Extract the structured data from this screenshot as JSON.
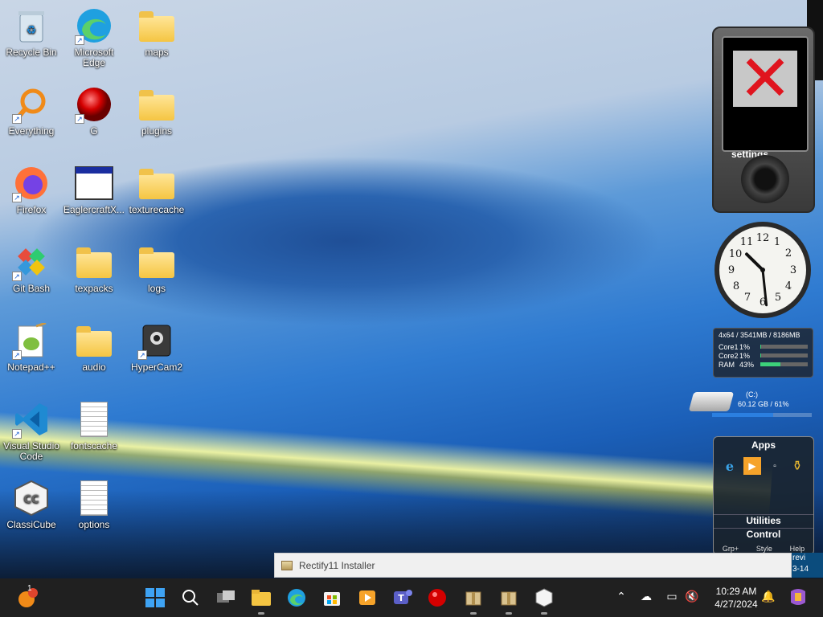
{
  "desktop": {
    "icons": [
      {
        "label": "Recycle Bin"
      },
      {
        "label": "Microsoft Edge"
      },
      {
        "label": "maps"
      },
      {
        "label": "Everything"
      },
      {
        "label": "G"
      },
      {
        "label": "plugins"
      },
      {
        "label": "Firefox"
      },
      {
        "label": "EaglercraftX..."
      },
      {
        "label": "texturecache"
      },
      {
        "label": "Git Bash"
      },
      {
        "label": "texpacks"
      },
      {
        "label": "logs"
      },
      {
        "label": "Notepad++"
      },
      {
        "label": "audio"
      },
      {
        "label": "HyperCam2"
      },
      {
        "label": "Visual Studio Code"
      },
      {
        "label": "fontscache"
      },
      {
        "label": "ClassiCube"
      },
      {
        "label": "options"
      }
    ]
  },
  "gadgets": {
    "zune": {
      "settings_label": "settings"
    },
    "clock": {
      "hour": 10,
      "minute": 29
    },
    "cpu": {
      "header": "4x64 / 3541MB / 8186MB",
      "rows": [
        {
          "label": "Core1",
          "value": "1%",
          "fraction": 0.01
        },
        {
          "label": "Core2",
          "value": "1%",
          "fraction": 0.01
        },
        {
          "label": "RAM",
          "value": "43%",
          "fraction": 0.43
        }
      ]
    },
    "drive": {
      "name": "(C:)",
      "info": "60.12 GB / 61%",
      "fraction": 0.61
    },
    "apps": {
      "title": "Apps",
      "section_utilities": "Utilities",
      "section_control": "Control",
      "footer": [
        "Grp+",
        "Style",
        "Help"
      ]
    }
  },
  "installer_window": {
    "title": "Rectify11 Installer",
    "side_text_1": "revi",
    "side_text_2": "3-14"
  },
  "taskbar": {
    "notification_count": "1",
    "time": "10:29 AM",
    "date": "4/27/2024"
  },
  "colors": {
    "taskbar_bg": "#202020",
    "accent": "#0078d4"
  }
}
